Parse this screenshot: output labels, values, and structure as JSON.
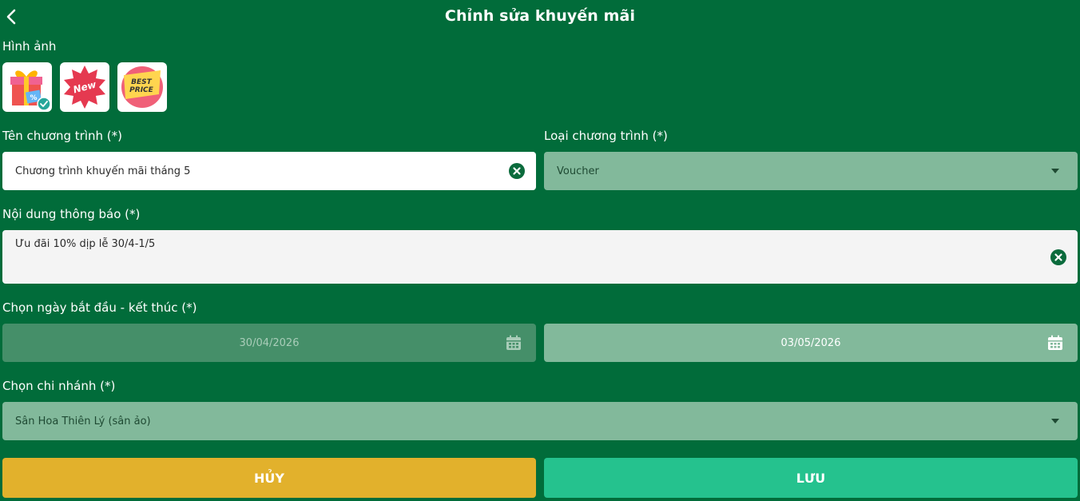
{
  "header": {
    "title": "Chỉnh sửa khuyến mãi",
    "back_icon": "chevron-left-icon"
  },
  "images": {
    "label": "Hình ảnh",
    "items": [
      {
        "name": "gift-image",
        "selected": true
      },
      {
        "name": "new-badge-image",
        "text": "New",
        "selected": false
      },
      {
        "name": "best-price-image",
        "text_line1": "BEST",
        "text_line2": "PRICE",
        "selected": false
      }
    ]
  },
  "program_name": {
    "label": "Tên chương trình (*)",
    "value": "Chương trình khuyến mãi tháng 5"
  },
  "program_type": {
    "label": "Loại chương trình (*)",
    "value": "Voucher"
  },
  "notification": {
    "label": "Nội dung thông báo (*)",
    "value": "Ưu đãi 10% dịp lễ 30/4-1/5"
  },
  "date_range": {
    "label": "Chọn ngày bắt đầu - kết thúc (*)",
    "start": "30/04/2026",
    "end": "03/05/2026"
  },
  "branch": {
    "label": "Chọn chi nhánh (*)",
    "value": "Sân Hoa Thiên Lý (sân ảo)"
  },
  "actions": {
    "cancel_label": "HỦY",
    "save_label": "LƯU"
  },
  "colors": {
    "background": "#016c3a",
    "cancel": "#e2b12c",
    "save": "#25c28e",
    "dropdown": "#82b99b",
    "icon": "#0b6b3c"
  }
}
